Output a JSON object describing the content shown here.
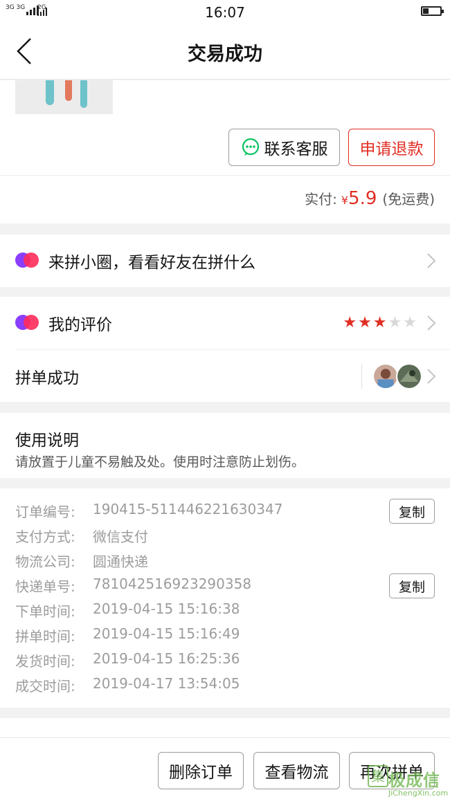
{
  "status_bar": {
    "sim1": "3G 3G",
    "sim2": "2G",
    "time": "16:07"
  },
  "navbar": {
    "title": "交易成功"
  },
  "order_actions": {
    "contact_service": "联系客服",
    "request_refund": "申请退款"
  },
  "payment": {
    "label": "实付:",
    "currency": "¥",
    "amount": "5.9",
    "shipping_note": "(免运费)"
  },
  "circle": {
    "label": "来拼小圈，看看好友在拼什么"
  },
  "review": {
    "label": "我的评价",
    "rating": 3,
    "max_rating": 5
  },
  "group": {
    "label": "拼单成功"
  },
  "usage": {
    "title": "使用说明",
    "text": "请放置于儿童不易触及处。使用时注意防止划伤。"
  },
  "order_info": {
    "copy_label": "复制",
    "rows": [
      {
        "key": "订单编号:",
        "value": "190415-511446221630347"
      },
      {
        "key": "支付方式:",
        "value": "微信支付"
      },
      {
        "key": "物流公司:",
        "value": "圆通快递"
      },
      {
        "key": "快递单号:",
        "value": "781042516923290358"
      },
      {
        "key": "下单时间:",
        "value": "2019-04-15 15:16:38"
      },
      {
        "key": "拼单时间:",
        "value": "2019-04-15 15:16:49"
      },
      {
        "key": "发货时间:",
        "value": "2019-04-15 16:25:36"
      },
      {
        "key": "成交时间:",
        "value": "2019-04-17 13:54:05"
      }
    ]
  },
  "bottom_bar": {
    "delete_order": "删除订单",
    "view_logistics": "查看物流",
    "reorder": "再次拼单"
  },
  "watermark": {
    "name": "极成信",
    "url": "JiChengXin.com"
  },
  "colors": {
    "accent_red": "#e02e24",
    "wechat_green": "#07c160",
    "star_on": "#e02e24",
    "star_off": "#d8d8d8"
  }
}
